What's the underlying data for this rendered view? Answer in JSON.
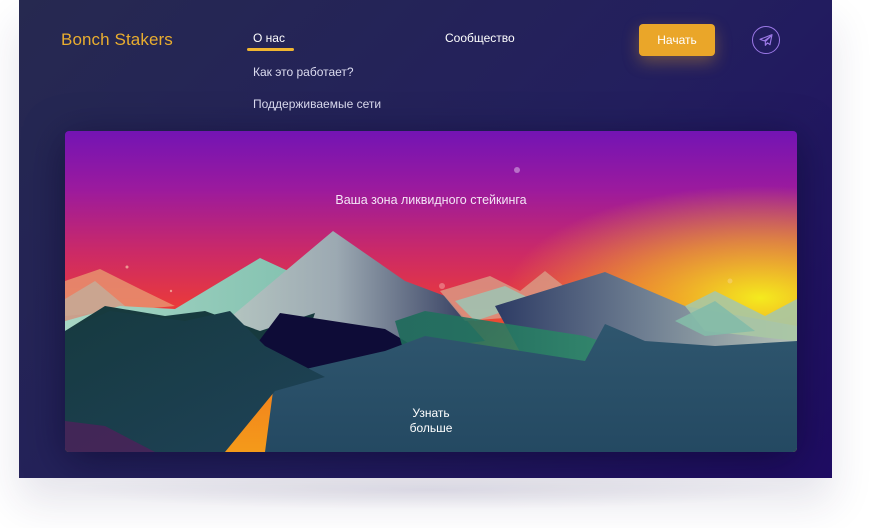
{
  "header": {
    "logo": "Bonch Stakers",
    "nav": {
      "about": "О нас",
      "how_it_works": "Как это работает?",
      "supported_networks": "Поддерживаемые сети",
      "community": "Сообщество"
    },
    "start_button": "Начать",
    "telegram_icon": "telegram-icon"
  },
  "hero": {
    "tagline": "Ваша зона ликвидного стейкинга",
    "learn_more_line1": "Узнать",
    "learn_more_line2": "больше",
    "illustration": "mountains-sunset"
  },
  "colors": {
    "accent": "#eaa629",
    "logo": "#e9ad2f",
    "page_bg": "#231f5e",
    "telegram_ring": "#9b78e6"
  }
}
